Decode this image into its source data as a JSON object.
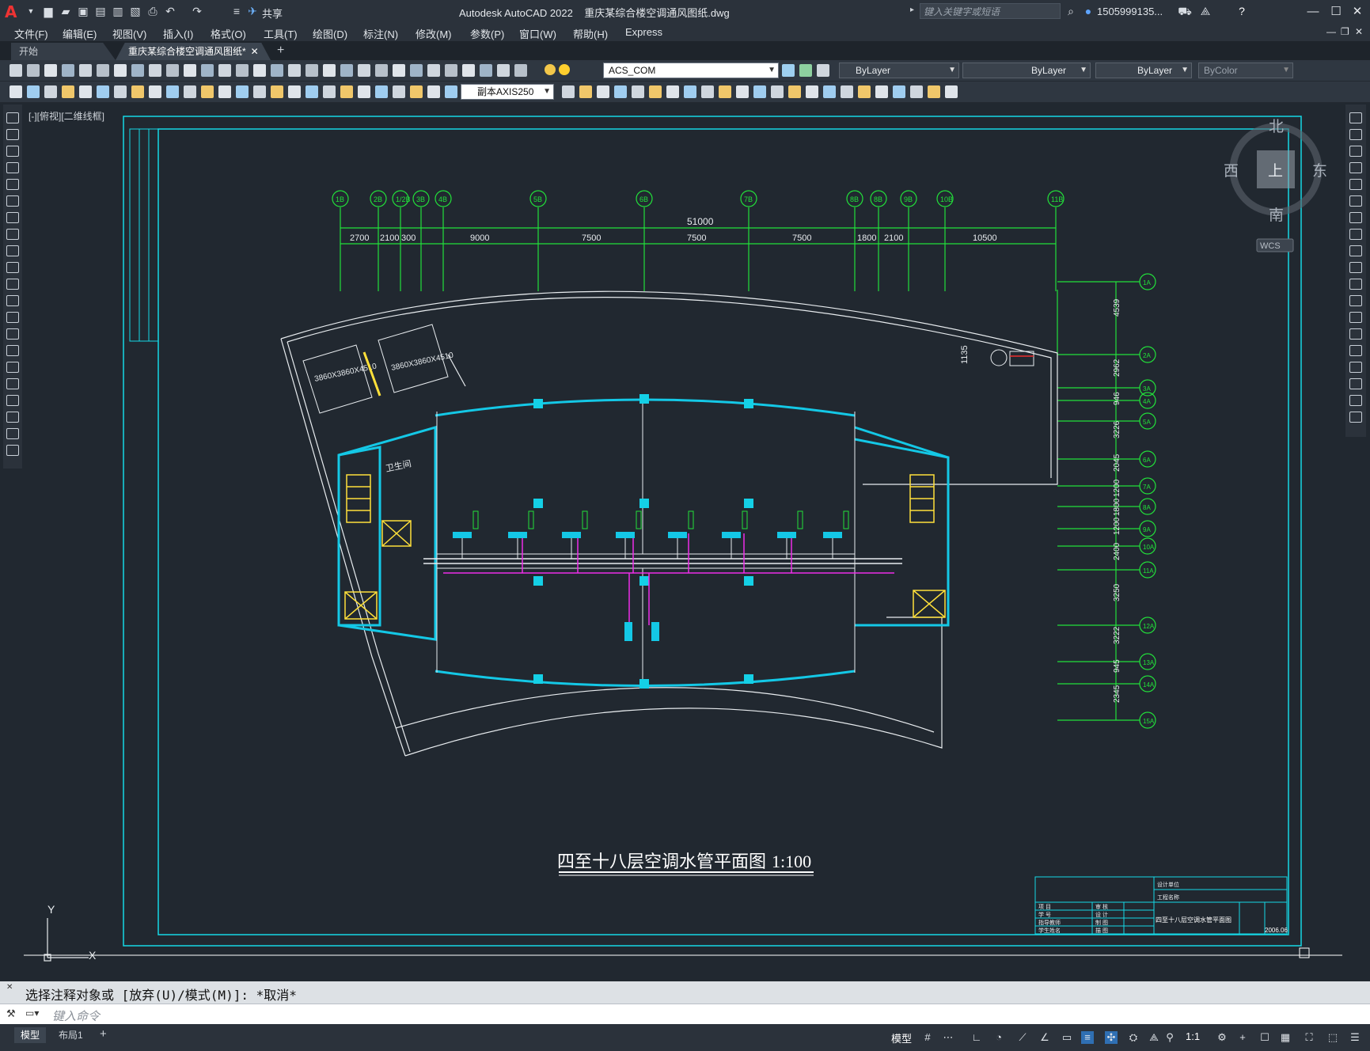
{
  "app": {
    "title": "Autodesk AutoCAD 2022",
    "document": "重庆某综合楼空调通风图纸.dwg",
    "search_placeholder": "键入关键字或短语",
    "user": "1505999135...",
    "share_label": "共享"
  },
  "menu": [
    "文件(F)",
    "编辑(E)",
    "视图(V)",
    "插入(I)",
    "格式(O)",
    "工具(T)",
    "绘图(D)",
    "标注(N)",
    "修改(M)",
    "参数(P)",
    "窗口(W)",
    "帮助(H)",
    "Express"
  ],
  "tabs": {
    "start": "开始",
    "doc": "重庆某综合楼空调通风图纸*",
    "close": "✕",
    "add": "+"
  },
  "toolbar": {
    "layer": "ACS_COM",
    "color": "ByLayer",
    "linetype": "ByLayer",
    "lineweight": "ByLayer",
    "plotstyle": "ByColor",
    "dimstyle": "副本AXIS250"
  },
  "viewport": {
    "label": "[-][俯视][二维线框]",
    "cube": {
      "n": "北",
      "s": "南",
      "e": "东",
      "w": "西",
      "top": "上",
      "wcs": "WCS"
    }
  },
  "drawing": {
    "title": "四至十八层空调水管平面图",
    "scale": "1:100",
    "overall_dim": "51000",
    "top_dims": [
      "2700",
      "2100",
      "300",
      "9000",
      "7500",
      "7500",
      "7500",
      "1800",
      "2100",
      "10500"
    ],
    "top_axes": [
      "1B",
      "2B",
      "1/2B",
      "3B",
      "4B",
      "5B",
      "6B",
      "7B",
      "8B",
      "8B",
      "9B",
      "10B",
      "11B"
    ],
    "right_dims": [
      "4539",
      "2962",
      "946",
      "3226",
      "2045",
      "1200",
      "1800",
      "1200",
      "2400",
      "3250",
      "3222",
      "945",
      "2345"
    ],
    "right_axes": [
      "1A",
      "2A",
      "3A",
      "4A",
      "5A",
      "6A",
      "7A",
      "8A",
      "9A",
      "10A",
      "11A",
      "12A",
      "13A",
      "14A",
      "15A"
    ],
    "tank_label": "3860X3860X4510",
    "toilet_label": "卫生间",
    "ucs_y": "Y",
    "ucs_x": "X",
    "title_block": {
      "project": "设计单位",
      "name": "工程名称",
      "drawing_name": "四至十八层空调水管平面图",
      "date": "2006.06",
      "rows": [
        "项  目",
        "学  号",
        "指导教师",
        "学生姓名"
      ],
      "rows2": [
        "审  核",
        "设  计",
        "制  图",
        "描  图"
      ]
    }
  },
  "command": {
    "history": "选择注释对象或 [放弃(U)/模式(M)]: *取消*",
    "placeholder": "键入命令"
  },
  "status": {
    "tabs": [
      "模型",
      "布局1"
    ],
    "model_btn": "模型",
    "scale": "1:1"
  }
}
